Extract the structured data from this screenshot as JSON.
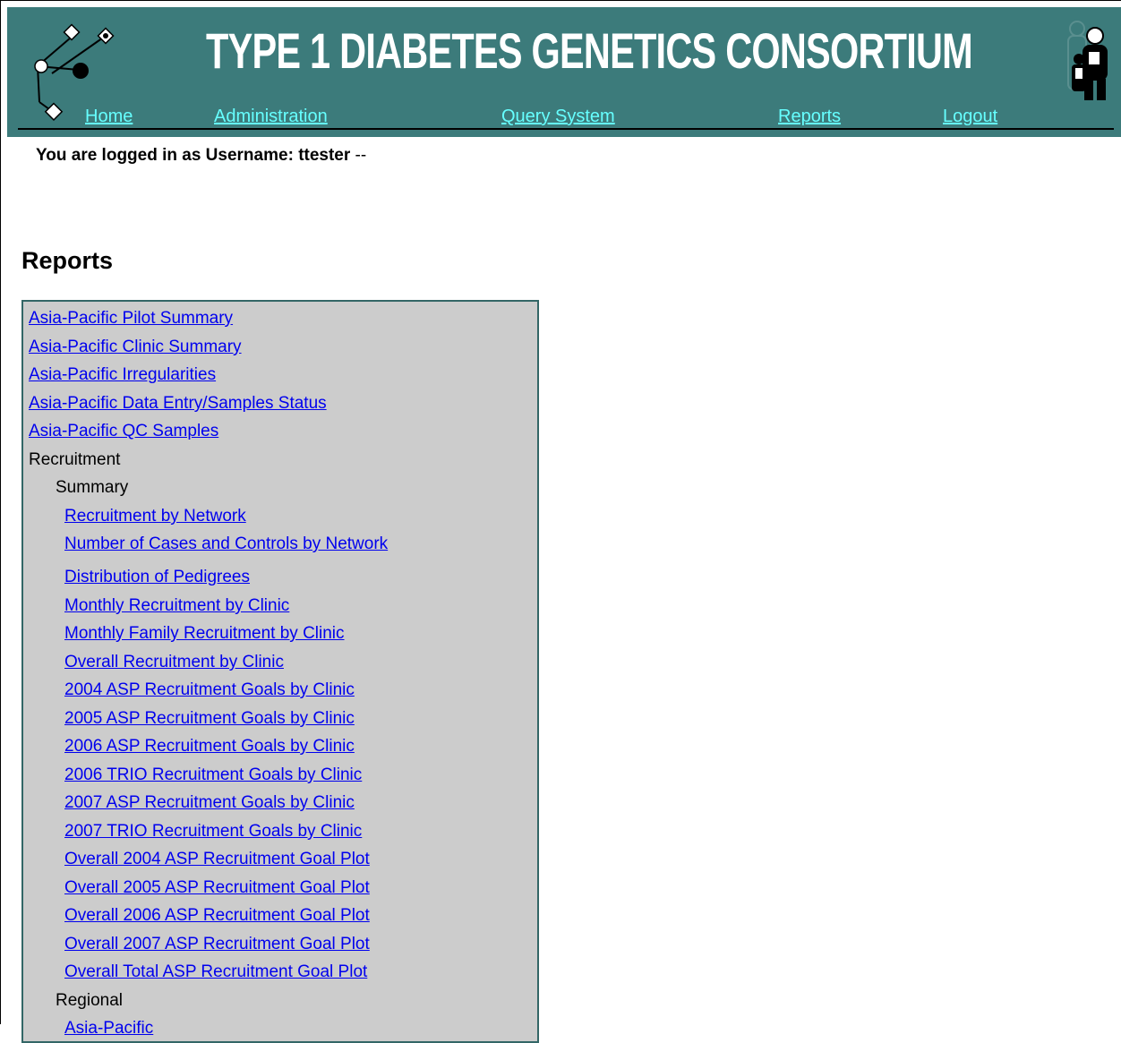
{
  "header": {
    "title": "TYPE 1 DIABETES GENETICS CONSORTIUM",
    "nav": [
      "Home",
      "Administration",
      "Query System",
      "Reports",
      "Logout"
    ],
    "colors": {
      "banner": "#3c7b7b",
      "nav_link": "#66ffff",
      "title": "#ffffff"
    },
    "icons": {
      "left_logo": "pedigree-logo-icon",
      "right_logo": "family-figures-icon"
    }
  },
  "login": {
    "label": "You are logged in as Username:",
    "username": "ttester",
    "suffix": "--"
  },
  "page": {
    "heading": "Reports"
  },
  "reports": {
    "items": [
      {
        "label": "Asia-Pacific Pilot Summary",
        "kind": "link"
      },
      {
        "label": "Asia-Pacific Clinic Summary",
        "kind": "link"
      },
      {
        "label": "Asia-Pacific Irregularities",
        "kind": "link"
      },
      {
        "label": "Asia-Pacific Data Entry/Samples Status",
        "kind": "link"
      },
      {
        "label": "Asia-Pacific QC Samples",
        "kind": "link"
      },
      {
        "label": "Recruitment",
        "kind": "heading"
      },
      {
        "label": "Summary",
        "kind": "heading"
      },
      {
        "label": "Recruitment by Network",
        "kind": "link"
      },
      {
        "label": "Number of Cases and Controls by Network",
        "kind": "link"
      },
      {
        "label": "Distribution of Pedigrees",
        "kind": "link"
      },
      {
        "label": "Monthly Recruitment by Clinic",
        "kind": "link"
      },
      {
        "label": "Monthly Family Recruitment by Clinic",
        "kind": "link"
      },
      {
        "label": "Overall Recruitment by Clinic",
        "kind": "link"
      },
      {
        "label": "2004 ASP Recruitment Goals by Clinic",
        "kind": "link"
      },
      {
        "label": "2005 ASP Recruitment Goals by Clinic",
        "kind": "link"
      },
      {
        "label": "2006 ASP Recruitment Goals by Clinic",
        "kind": "link"
      },
      {
        "label": "2006 TRIO Recruitment Goals by Clinic",
        "kind": "link"
      },
      {
        "label": "2007 ASP Recruitment Goals by Clinic",
        "kind": "link"
      },
      {
        "label": "2007 TRIO Recruitment Goals by Clinic",
        "kind": "link"
      },
      {
        "label": "Overall 2004 ASP Recruitment Goal Plot",
        "kind": "link"
      },
      {
        "label": "Overall 2005 ASP Recruitment Goal Plot",
        "kind": "link"
      },
      {
        "label": "Overall 2006 ASP Recruitment Goal Plot",
        "kind": "link"
      },
      {
        "label": "Overall 2007 ASP Recruitment Goal Plot",
        "kind": "link"
      },
      {
        "label": "Overall Total ASP Recruitment Goal Plot",
        "kind": "link"
      },
      {
        "label": "Regional",
        "kind": "heading"
      },
      {
        "label": "Asia-Pacific",
        "kind": "link"
      }
    ]
  }
}
